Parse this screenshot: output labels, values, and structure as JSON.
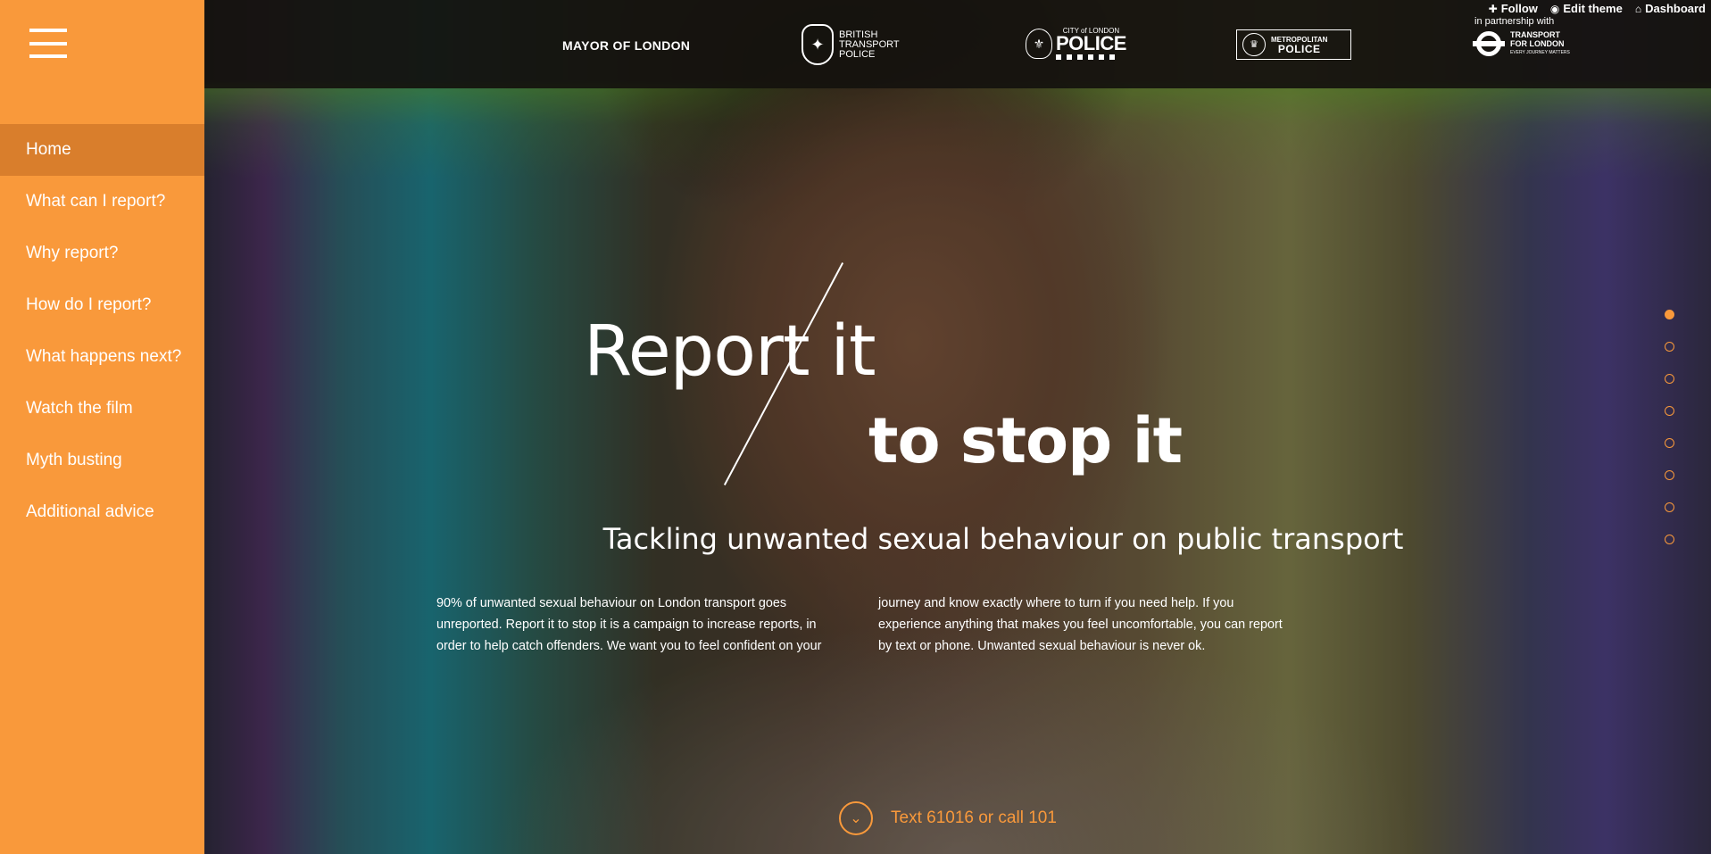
{
  "sidebar": {
    "items": [
      {
        "label": "Home",
        "active": true
      },
      {
        "label": "What can I report?"
      },
      {
        "label": "Why report?"
      },
      {
        "label": "How do I report?"
      },
      {
        "label": "What happens next?"
      },
      {
        "label": "Watch the film"
      },
      {
        "label": "Myth busting"
      },
      {
        "label": "Additional advice"
      }
    ]
  },
  "admin": {
    "follow": "Follow",
    "edit_theme": "Edit theme",
    "dashboard": "Dashboard"
  },
  "partners": {
    "mayor": "MAYOR OF LONDON",
    "btp": [
      "BRITISH",
      "TRANSPORT",
      "POLICE"
    ],
    "col_small": "CITY of LONDON",
    "col_big": "POLICE",
    "met_top": "METROPOLITAN",
    "met_bottom": "POLICE",
    "partnership": "in partnership with",
    "tfl_1": "TRANSPORT",
    "tfl_2": "FOR LONDON",
    "tfl_tagline": "EVERY JOURNEY MATTERS"
  },
  "hero": {
    "headline_1": "Report it",
    "headline_2": "to stop it",
    "subtitle": "Tackling unwanted sexual behaviour on public transport",
    "intro": "90% of unwanted sexual behaviour on London transport goes unreported. Report it to stop it is a campaign to increase reports, in order to help catch offenders. We want you to feel confident on your journey and know exactly where to turn if you need help. If you experience anything that makes you feel uncomfortable, you can report by text or phone. Unwanted sexual behaviour is never ok.",
    "cta": "Text 61016 or call 101"
  },
  "slide_dots": {
    "count": 8,
    "active": 0
  },
  "colors": {
    "accent": "#f9993b",
    "sidebar_active": "#d97e2c"
  },
  "icons": {
    "menu": "hamburger-icon",
    "follow": "plus-icon",
    "edit_theme": "eye-icon",
    "dashboard": "home-icon",
    "cta": "chevron-down-icon"
  }
}
